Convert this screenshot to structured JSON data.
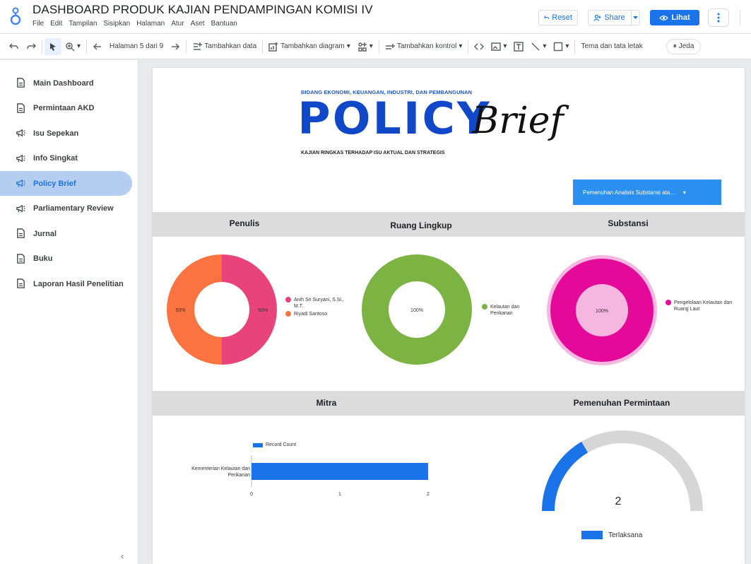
{
  "app": {
    "title": "DASHBOARD PRODUK KAJIAN PENDAMPINGAN KOMISI IV",
    "menu": [
      "File",
      "Edit",
      "Tampilan",
      "Sisipkan",
      "Halaman",
      "Atur",
      "Aset",
      "Bantuan"
    ],
    "buttons": {
      "reset": "Reset",
      "share": "Share",
      "view": "Lihat"
    }
  },
  "toolbar": {
    "page_indicator": "Halaman 5 dari 9",
    "add_data": "Tambahkan data",
    "add_chart": "Tambahkan diagram",
    "add_control": "Tambahkan kontrol",
    "theme_layout": "Tema dan tata letak",
    "pause": "Jeda"
  },
  "sidebar": {
    "items": [
      {
        "label": "Main Dashboard",
        "icon": "document-icon",
        "active": false
      },
      {
        "label": "Permintaan AKD",
        "icon": "document-icon",
        "active": false
      },
      {
        "label": "Isu Sepekan",
        "icon": "megaphone-icon",
        "active": false
      },
      {
        "label": "Info Singkat",
        "icon": "megaphone-icon",
        "active": false
      },
      {
        "label": "Policy Brief",
        "icon": "megaphone-icon",
        "active": true
      },
      {
        "label": "Parliamentary Review",
        "icon": "megaphone-icon",
        "active": false
      },
      {
        "label": "Jurnal",
        "icon": "document-icon",
        "active": false
      },
      {
        "label": "Buku",
        "icon": "document-icon",
        "active": false
      },
      {
        "label": "Laporan Hasil Penelitian",
        "icon": "document-icon",
        "active": false
      }
    ],
    "collapse": "‹"
  },
  "report": {
    "kicker": "BIDANG EKONOMI, KEUANGAN, INDUSTRI, DAN PEMBANGUNAN",
    "title_main": "POLICY",
    "title_script": "Brief",
    "subkicker": "KAJIAN RINGKAS TERHADAP ISU AKTUAL DAN STRATEGIS",
    "filter_value": "Pemenuhan Analisis Substansi ata...",
    "headers": {
      "penulis": "Penulis",
      "ruang": "Ruang Lingkup",
      "substansi": "Substansi",
      "mitra": "Mitra",
      "pemenuhan": "Pemenuhan Permintaan"
    }
  },
  "colors": {
    "accent": "#1a73e8",
    "pink": "#e8437a",
    "orange": "#fb7340",
    "green": "#7cb342",
    "magenta": "#e5099a",
    "gauge_track": "#d6d6d6"
  },
  "chart_data": [
    {
      "type": "pie",
      "title": "Penulis",
      "slices": [
        {
          "label": "Anih Sri Suryani, S.Si., M.T.",
          "value": 50,
          "display": "50%",
          "color": "#e8437a"
        },
        {
          "label": "Riyadi Santoso",
          "value": 50,
          "display": "50%",
          "color": "#fb7340"
        }
      ]
    },
    {
      "type": "pie",
      "title": "Ruang Lingkup",
      "slices": [
        {
          "label": "Kelautan dan Perikanan",
          "value": 100,
          "display": "100%",
          "color": "#7cb342"
        }
      ]
    },
    {
      "type": "pie",
      "title": "Substansi",
      "slices": [
        {
          "label": "Pengelolaan Kelautan dan Ruang Laut",
          "value": 100,
          "display": "100%",
          "color": "#e5099a"
        }
      ]
    },
    {
      "type": "bar",
      "title": "Mitra",
      "categories": [
        "Kementerian Kelautan dan Perikanan"
      ],
      "series": [
        {
          "name": "Record Count",
          "values": [
            2
          ]
        }
      ],
      "xticks": [
        "0",
        "1",
        "2"
      ],
      "xlim": [
        0,
        2
      ]
    },
    {
      "type": "gauge",
      "title": "Pemenuhan Permintaan",
      "value": 2,
      "display": "2",
      "fraction": 0.33,
      "legend": "Terlaksana"
    }
  ]
}
